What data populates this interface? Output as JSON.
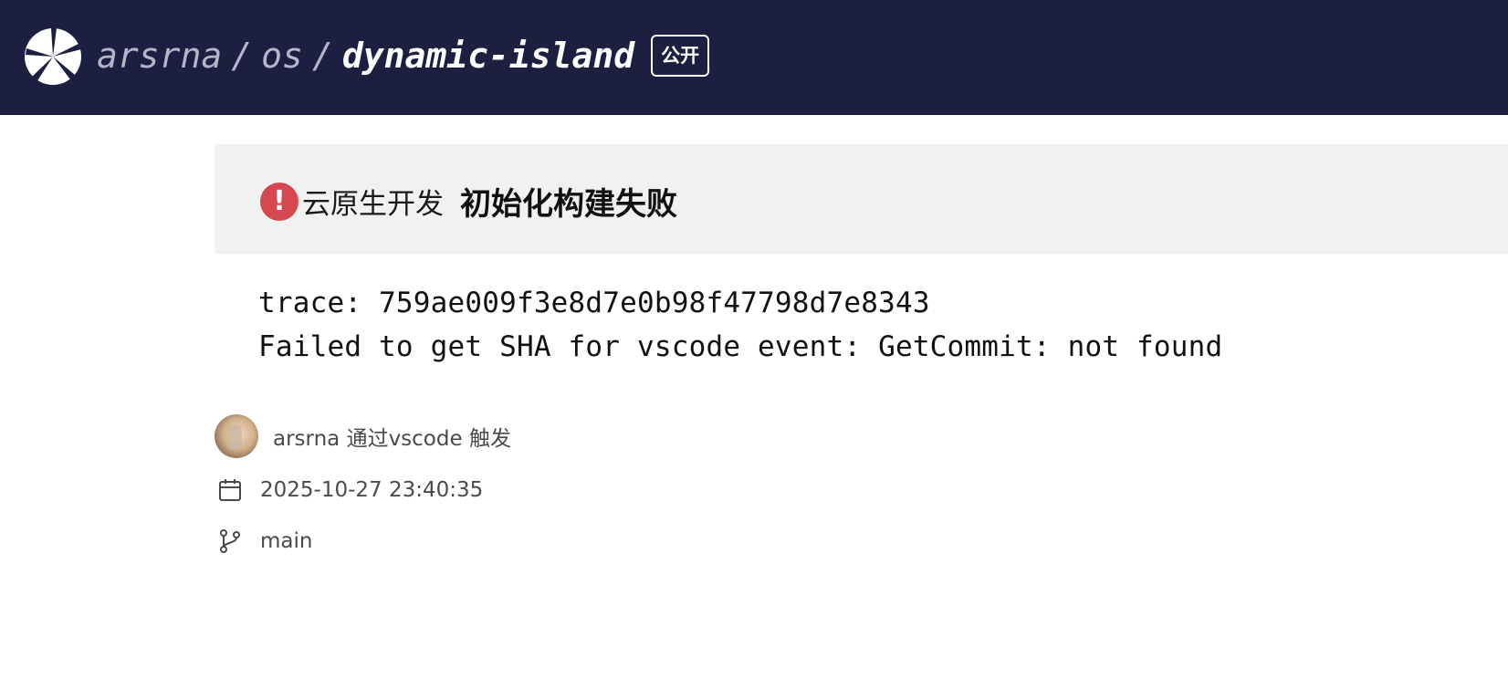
{
  "header": {
    "owner": "arsrna",
    "group": "os",
    "separator": "/",
    "repo": "dynamic-island",
    "visibility": "公开",
    "background_color": "#1c1f3f"
  },
  "banner": {
    "status_icon": "error-icon",
    "status_color": "#d6484f",
    "status_glyph": "!",
    "source": "云原生开发",
    "title": "初始化构建失败"
  },
  "log": {
    "lines": [
      "trace: 759ae009f3e8d7e0b98f47798d7e8343",
      "Failed to get SHA for vscode event: GetCommit: not found"
    ]
  },
  "meta": {
    "trigger": "arsrna 通过vscode 触发",
    "datetime": "2025-10-27 23:40:35",
    "datetime_icon": "calendar-icon",
    "branch": "main",
    "branch_icon": "branch-icon"
  }
}
